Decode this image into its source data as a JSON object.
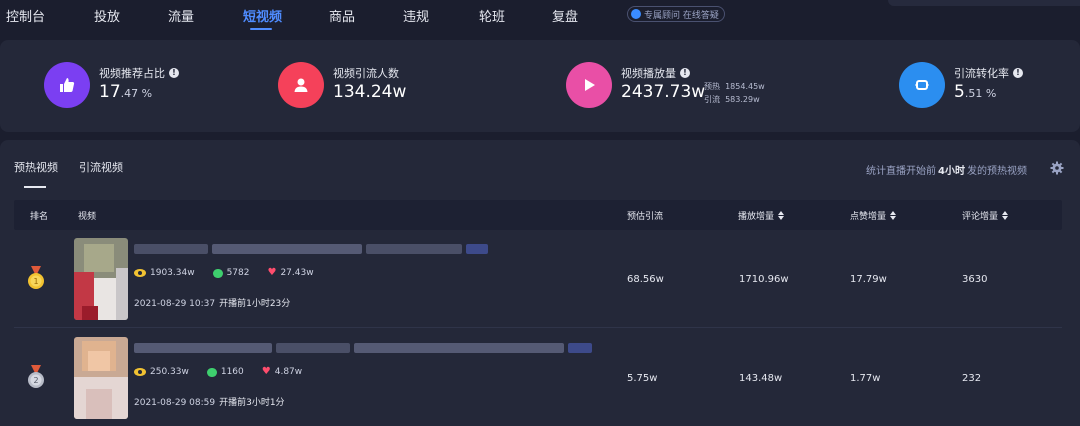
{
  "nav": {
    "tabs": [
      {
        "label": "控制台"
      },
      {
        "label": "投放"
      },
      {
        "label": "流量"
      },
      {
        "label": "短视频"
      },
      {
        "label": "商品"
      },
      {
        "label": "违规"
      },
      {
        "label": "轮班"
      },
      {
        "label": "复盘"
      }
    ],
    "active_tab": "短视频",
    "consultant_label": "专属顾问 在线答疑"
  },
  "stats": [
    {
      "label": "视频推荐占比",
      "value_main": "17",
      "value_small": ".47 %",
      "icon": "thumbs-up-icon",
      "color": "#7b3ff2"
    },
    {
      "label": "视频引流人数",
      "value_main": "134.24w",
      "value_small": "",
      "icon": "user-icon",
      "color": "#f5415a"
    },
    {
      "label": "视频播放量",
      "value_main": "2437.73w",
      "value_small": "",
      "icon": "play-icon",
      "color": "#e94fa6",
      "sub": [
        {
          "label": "预热",
          "value": "1854.45w"
        },
        {
          "label": "引流",
          "value": "583.29w"
        }
      ]
    },
    {
      "label": "引流转化率",
      "value_main": "5",
      "value_small": ".51 %",
      "icon": "conversion-icon",
      "color": "#2b8ef0"
    }
  ],
  "content": {
    "subtabs": [
      {
        "label": "预热视频"
      },
      {
        "label": "引流视频"
      }
    ],
    "active_subtab": "预热视频",
    "note_prefix": "统计直播开始前",
    "note_value": "4小时",
    "note_suffix": "发的预热视频",
    "columns": {
      "rank": "排名",
      "video": "视频",
      "est_traffic": "预估引流",
      "play_inc": "播放增量",
      "like_inc": "点赞增量",
      "comment_inc": "评论增量"
    },
    "rows": [
      {
        "rank": "1",
        "medal_color": "#f2c230",
        "views": "1903.34w",
        "comments": "5782",
        "likes": "27.43w",
        "time": "2021-08-29 10:37",
        "pre": "开播前1小时23分",
        "est_traffic": "68.56w",
        "play_inc": "1710.96w",
        "like_inc": "17.79w",
        "comment_inc": "3630"
      },
      {
        "rank": "2",
        "medal_color": "#b8bcc8",
        "views": "250.33w",
        "comments": "1160",
        "likes": "4.87w",
        "time": "2021-08-29 08:59",
        "pre": "开播前3小时1分",
        "est_traffic": "5.75w",
        "play_inc": "143.48w",
        "like_inc": "1.77w",
        "comment_inc": "232"
      }
    ]
  }
}
